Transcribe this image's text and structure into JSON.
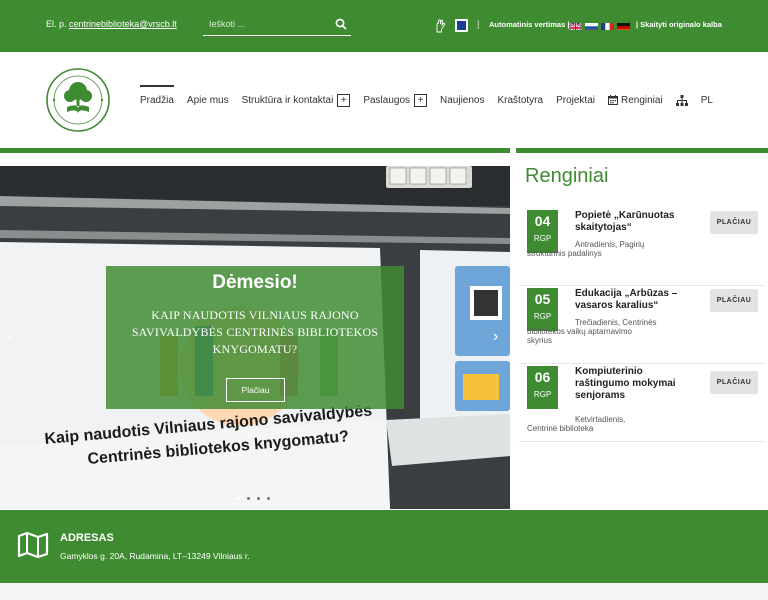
{
  "topbar": {
    "email_prefix": "El. p.",
    "email": "centrinebiblioteka@vrscb.lt",
    "search_placeholder": "Ieškoti ...",
    "auto_translate": "Automatinis vertimas |",
    "view_original": "| Skaityti originalo kalba",
    "separator": "|",
    "flags": [
      "gb-flag",
      "ru-flag",
      "fr-flag",
      "de-flag"
    ]
  },
  "nav": {
    "items": [
      {
        "label": "Pradžia"
      },
      {
        "label": "Apie mus"
      },
      {
        "label": "Struktūra ir kontaktai"
      },
      {
        "label": "Paslaugos"
      },
      {
        "label": "Naujienos"
      },
      {
        "label": "Kraštotyra"
      },
      {
        "label": "Projektai"
      },
      {
        "label": "Renginiai"
      },
      {
        "label": "PL"
      }
    ],
    "plus": "+"
  },
  "slide": {
    "title": "Dėmesio!",
    "text": "KAIP NAUDOTIS VILNIAUS RAJONO SAVIVALDYBĖS CENTRINĖS BIBLIOTEKOS KNYGOMATU?",
    "button": "Plačiau",
    "photo_line1": "Kaip naudotis Vilniaus rajono savivaldybės",
    "photo_line2": "Centrinės bibliotekos knygomatu?",
    "prev": "‹",
    "next": "›",
    "dots": 4,
    "active_dot": 0
  },
  "events": {
    "title": "Renginiai",
    "items": [
      {
        "day": "04",
        "month": "RGP",
        "title": "Popietė „Karūnuotas skaitytojas“",
        "meta": "Antradienis, Pagirių struktūrinis padalinys",
        "button": "PLAČIAU"
      },
      {
        "day": "05",
        "month": "RGP",
        "title": "Edukacija „Arbūzas – vasaros karalius“",
        "meta": "Trečiadienis, Centrinės bibliotekos vaikų aptarnavimo skyrius",
        "button": "PLAČIAU"
      },
      {
        "day": "06",
        "month": "RGP",
        "title": "Kompiuterinio raštingumo mokymai senjorams",
        "meta": "Ketvirtadienis, Centrinė biblioteka",
        "button": "PLAČIAU"
      }
    ]
  },
  "footer": {
    "heading": "ADRESAS",
    "address": "Gamyklos g. 20A, Rudamina, LT–13249 Vilniaus r."
  },
  "colors": {
    "brand_green": "#3f8b32",
    "button_grey": "#e3e3e3"
  }
}
